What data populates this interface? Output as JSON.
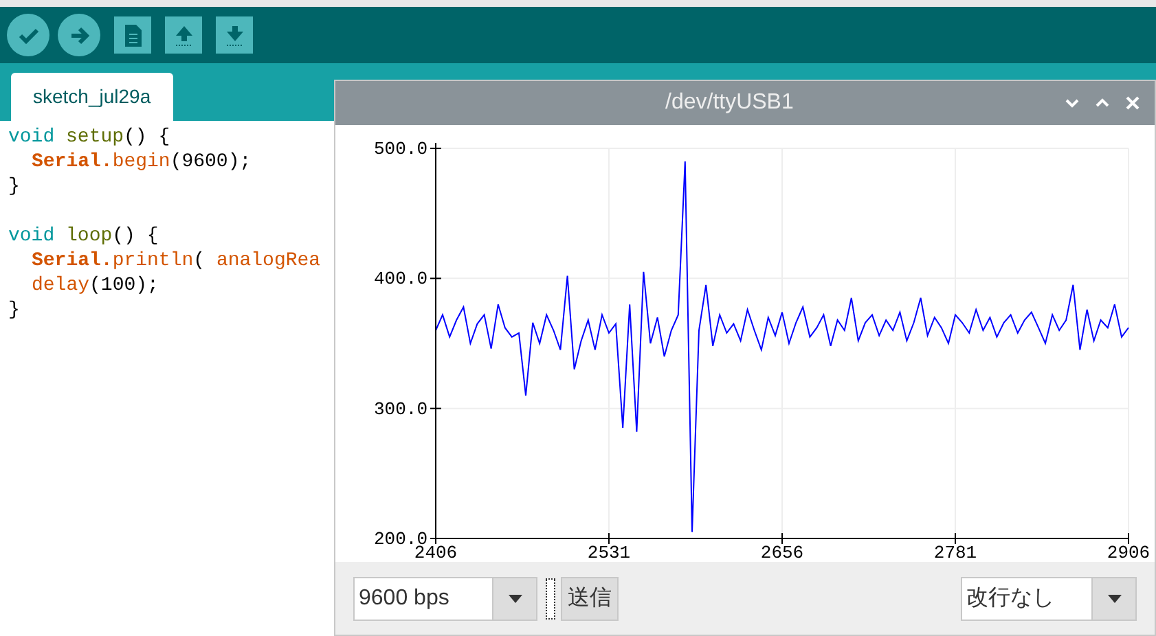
{
  "toolbar": {
    "buttons": [
      {
        "kind": "verify"
      },
      {
        "kind": "upload"
      },
      {
        "kind": "new"
      },
      {
        "kind": "open"
      },
      {
        "kind": "save"
      }
    ]
  },
  "tabs": [
    {
      "label": "sketch_jul29a",
      "selected": true
    }
  ],
  "editor": {
    "lines": [
      {
        "indent": false,
        "tokens": [
          {
            "kind": "keyword",
            "text": "void "
          },
          {
            "kind": "function",
            "text": "setup"
          },
          {
            "kind": "plain",
            "text": "() {"
          }
        ]
      },
      {
        "indent": true,
        "tokens": [
          {
            "kind": "class",
            "text": "Serial."
          },
          {
            "kind": "method",
            "text": "begin"
          },
          {
            "kind": "plain",
            "text": "(9600);"
          }
        ]
      },
      {
        "indent": false,
        "tokens": [
          {
            "kind": "plain",
            "text": "}"
          }
        ]
      },
      {
        "indent": false,
        "gap_before": true,
        "tokens": [
          {
            "kind": "keyword",
            "text": "void "
          },
          {
            "kind": "function",
            "text": "loop"
          },
          {
            "kind": "plain",
            "text": "() {"
          }
        ]
      },
      {
        "indent": true,
        "tokens": [
          {
            "kind": "class",
            "text": "Serial."
          },
          {
            "kind": "method",
            "text": "println"
          },
          {
            "kind": "plain",
            "text": "( "
          },
          {
            "kind": "method",
            "text": "analogRea"
          }
        ]
      },
      {
        "indent": true,
        "tokens": [
          {
            "kind": "method",
            "text": "delay"
          },
          {
            "kind": "plain",
            "text": "(100);"
          }
        ]
      },
      {
        "indent": false,
        "tokens": [
          {
            "kind": "plain",
            "text": "}"
          }
        ]
      }
    ]
  },
  "plotter": {
    "title": "/dev/ttyUSB1",
    "chart_data": {
      "type": "line",
      "grid": true,
      "x": [
        2406,
        2411,
        2416,
        2421,
        2426,
        2431,
        2436,
        2441,
        2446,
        2451,
        2456,
        2461,
        2466,
        2471,
        2476,
        2481,
        2486,
        2491,
        2496,
        2501,
        2506,
        2511,
        2516,
        2521,
        2526,
        2531,
        2536,
        2541,
        2546,
        2551,
        2556,
        2561,
        2566,
        2571,
        2576,
        2581,
        2586,
        2591,
        2596,
        2601,
        2606,
        2611,
        2616,
        2621,
        2626,
        2631,
        2636,
        2641,
        2646,
        2651,
        2656,
        2661,
        2666,
        2671,
        2676,
        2681,
        2686,
        2691,
        2696,
        2701,
        2706,
        2711,
        2716,
        2721,
        2726,
        2731,
        2736,
        2741,
        2746,
        2751,
        2756,
        2761,
        2766,
        2771,
        2776,
        2781,
        2786,
        2791,
        2796,
        2801,
        2806,
        2811,
        2816,
        2821,
        2826,
        2831,
        2836,
        2841,
        2846,
        2851,
        2856,
        2861,
        2866,
        2871,
        2876,
        2881,
        2886,
        2891,
        2896,
        2901,
        2906
      ],
      "xlim": [
        2406,
        2906
      ],
      "ylim": [
        200,
        500
      ],
      "xticks": [
        {
          "value": 2406,
          "label": "2406"
        },
        {
          "value": 2531,
          "label": "2531"
        },
        {
          "value": 2656,
          "label": "2656"
        },
        {
          "value": 2781,
          "label": "2781"
        },
        {
          "value": 2906,
          "label": "2906"
        }
      ],
      "yticks": [
        {
          "value": 200,
          "label": "200.0"
        },
        {
          "value": 300,
          "label": "300.0"
        },
        {
          "value": 400,
          "label": "400.0"
        },
        {
          "value": 500,
          "label": "500.0"
        }
      ],
      "series": [
        {
          "color": "#0000ff",
          "values": [
            360,
            372,
            355,
            368,
            378,
            350,
            365,
            372,
            346,
            380,
            362,
            355,
            358,
            310,
            366,
            350,
            372,
            360,
            345,
            402,
            330,
            352,
            368,
            345,
            372,
            358,
            365,
            285,
            380,
            282,
            405,
            350,
            370,
            340,
            360,
            372,
            490,
            205,
            360,
            395,
            348,
            372,
            358,
            365,
            352,
            376,
            360,
            345,
            370,
            356,
            374,
            350,
            366,
            378,
            355,
            362,
            372,
            348,
            368,
            360,
            385,
            352,
            366,
            372,
            356,
            368,
            360,
            374,
            352,
            366,
            385,
            356,
            370,
            362,
            350,
            372,
            366,
            358,
            376,
            360,
            370,
            355,
            366,
            372,
            358,
            368,
            374,
            362,
            350,
            372,
            360,
            368,
            395,
            345,
            376,
            352,
            368,
            362,
            380,
            355,
            362
          ]
        }
      ]
    },
    "baud": "9600 bps",
    "send": "送信",
    "line_ending": "改行なし"
  }
}
